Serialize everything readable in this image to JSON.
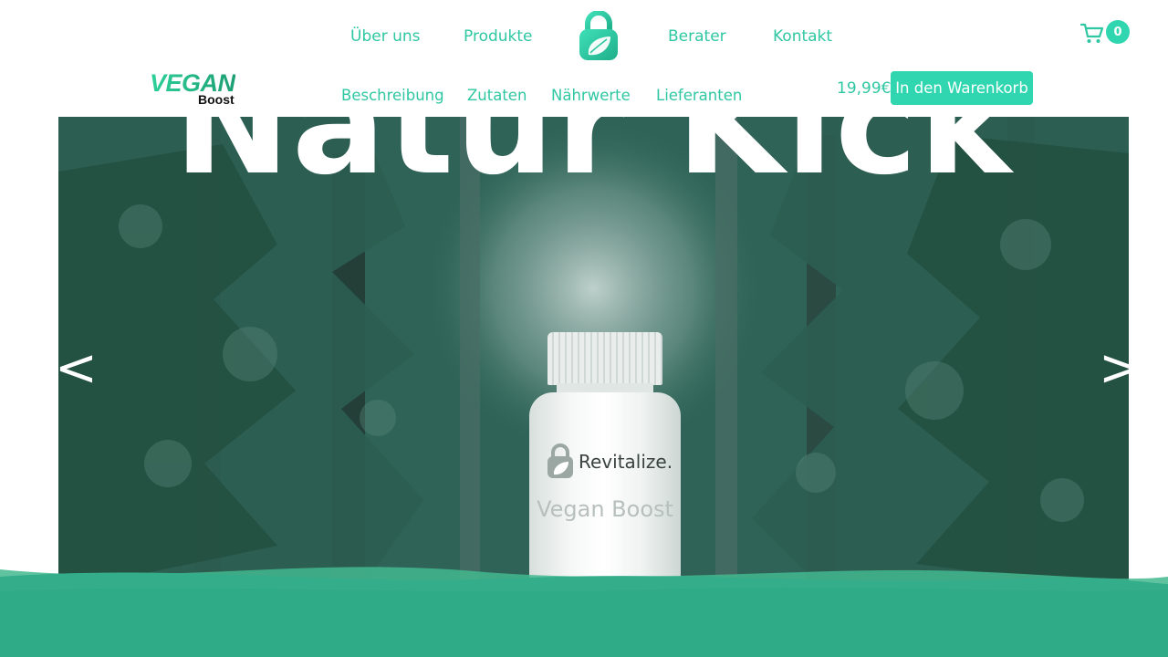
{
  "nav": {
    "links": [
      "Über uns",
      "Produkte",
      "Berater",
      "Kontakt"
    ]
  },
  "cart": {
    "count": "0"
  },
  "logo": {
    "main": "VEGAN",
    "sub": "Boost"
  },
  "subnav": {
    "links": [
      "Beschreibung",
      "Zutaten",
      "Nährwerte",
      "Lieferanten"
    ],
    "price": "19,99€",
    "cta": "In den Warenkorb"
  },
  "hero": {
    "title": "Natur Kick",
    "prev": "<",
    "next": ">",
    "bottle_brand": "Revitalize.",
    "bottle_product": "Vegan Boost"
  },
  "colors": {
    "accent": "#2fd6b0",
    "text_accent": "#2fc7a2",
    "wave": "#30ab87"
  }
}
